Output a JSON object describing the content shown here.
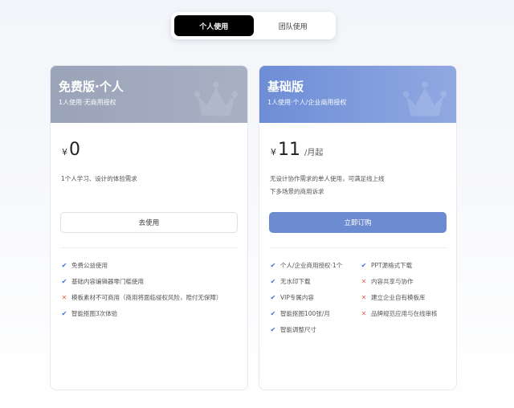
{
  "toggle": {
    "personal": "个人使用",
    "team": "团队使用",
    "active": "personal"
  },
  "colors": {
    "accent": "#6d8bd0",
    "check": "#3a6fd8",
    "cross": "#e0604e"
  },
  "plans": {
    "free": {
      "title": "免费版·个人",
      "subtitle": "1人使用·无商用授权",
      "currency": "¥",
      "price": "0",
      "desc": [
        "1个人学习、设计的体验需求"
      ],
      "cta": "去使用",
      "features": [
        {
          "text": "免费公益使用",
          "ok": true
        },
        {
          "text": "基础内容编辑器零门槛使用",
          "ok": true
        },
        {
          "text": "模板素材不可商用（商用将面临侵权风险，赔付无保障）",
          "ok": false
        },
        {
          "text": "智能抠图3次体验",
          "ok": true
        }
      ]
    },
    "basic": {
      "title": "基础版",
      "subtitle": "1人使用·个人/企业商用授权",
      "currency": "¥",
      "price": "11",
      "unit": "/月起",
      "desc": [
        "无设计协作需求的单人使用，可满足线上线",
        "下多场景的商用诉求"
      ],
      "cta": "立即订购",
      "features_left": [
        {
          "text": "个人/企业商用授权·1个",
          "ok": true
        },
        {
          "text": "无水印下载",
          "ok": true
        },
        {
          "text": "VIP专属内容",
          "ok": true
        },
        {
          "text": "智能抠图100张/月",
          "ok": true
        },
        {
          "text": "智能调整尺寸",
          "ok": true
        }
      ],
      "features_right": [
        {
          "text": "PPT源格式下载",
          "ok": true
        },
        {
          "text": "内容共享与协作",
          "ok": false
        },
        {
          "text": "建立企业自有模板库",
          "ok": false
        },
        {
          "text": "品牌规范应用与在线审核",
          "ok": false
        }
      ]
    }
  }
}
